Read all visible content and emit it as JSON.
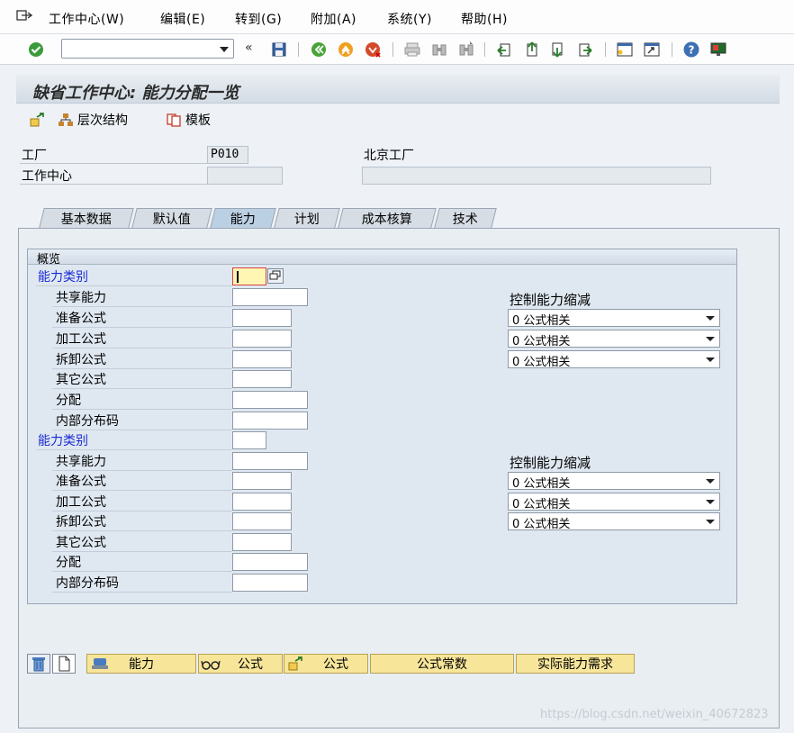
{
  "menu": {
    "items": [
      "工作中心(W)",
      "编辑(E)",
      "转到(G)",
      "附加(A)",
      "系统(Y)",
      "帮助(H)"
    ]
  },
  "toolbar": {
    "command_value": "",
    "collapse_glyph": "«"
  },
  "title": "缺省工作中心: 能力分配一览",
  "app_toolbar": {
    "buttons": [
      "层次结构",
      "模板"
    ]
  },
  "header": {
    "plant_label": "工厂",
    "plant_value": "P010",
    "plant_desc": "北京工厂",
    "wc_label": "工作中心",
    "wc_value": "",
    "wc_desc": ""
  },
  "tabs": [
    "基本数据",
    "默认值",
    "能力",
    "计划",
    "成本核算",
    "技术"
  ],
  "active_tab": "能力",
  "overview": {
    "title": "概览",
    "blocks": [
      {
        "category_label": "能力类别",
        "category_value": "",
        "shared_label": "共享能力",
        "setup_label": "准备公式",
        "process_label": "加工公式",
        "teardown_label": "拆卸公式",
        "other_label": "其它公式",
        "distribution_label": "分配",
        "internal_dist_label": "内部分布码",
        "control_label": "控制能力缩减",
        "setup_control": "0 公式相关",
        "process_control": "0 公式相关",
        "teardown_control": "0 公式相关"
      },
      {
        "category_label": "能力类别",
        "category_value": "",
        "shared_label": "共享能力",
        "setup_label": "准备公式",
        "process_label": "加工公式",
        "teardown_label": "拆卸公式",
        "other_label": "其它公式",
        "distribution_label": "分配",
        "internal_dist_label": "内部分布码",
        "control_label": "控制能力缩减",
        "setup_control": "0 公式相关",
        "process_control": "0 公式相关",
        "teardown_control": "0 公式相关"
      }
    ]
  },
  "bottom_buttons": [
    "能力",
    "公式",
    "公式",
    "公式常数",
    "实际能力需求"
  ],
  "watermark": "https://blog.csdn.net/weixin_40672823",
  "colors": {
    "button_yellow": "#f7e69a",
    "label_blue": "#1c2ad1",
    "focus_field": "#fff6b4"
  }
}
